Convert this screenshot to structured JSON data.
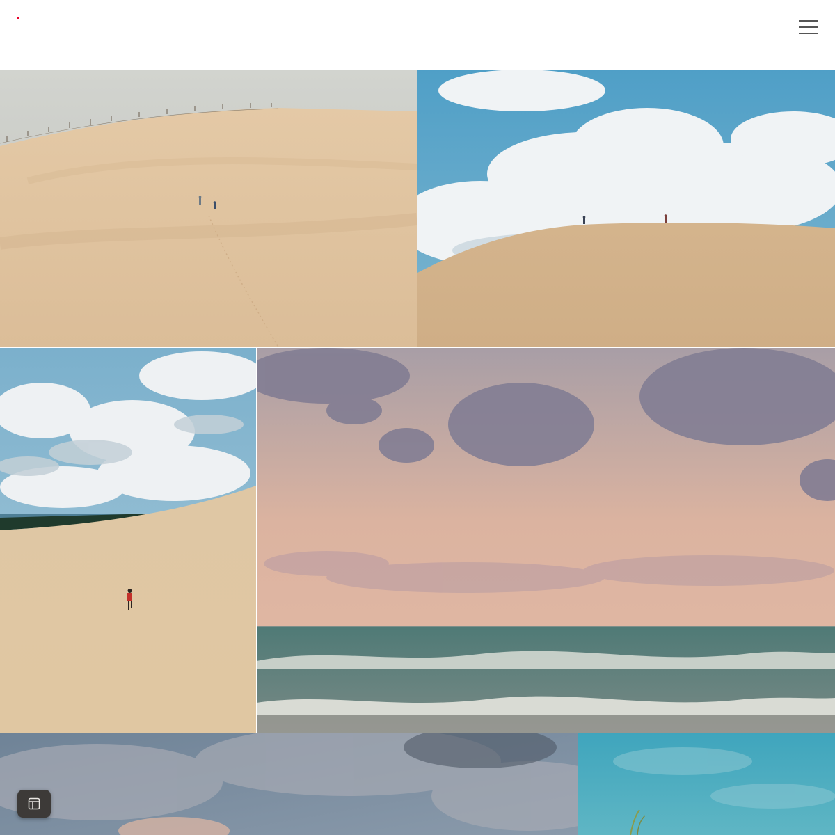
{
  "header": {
    "logo_dot_color": "#e8002a",
    "logo_icon": "logo-box",
    "menu_icon": "hamburger-menu-icon"
  },
  "gallery": {
    "tiles": [
      {
        "name": "photo-dune-fence-two-walkers",
        "icon": "photo"
      },
      {
        "name": "photo-dune-crest-clouds",
        "icon": "photo"
      },
      {
        "name": "photo-dune-child-running-lake",
        "icon": "photo"
      },
      {
        "name": "photo-sunset-lake-waves",
        "icon": "photo"
      },
      {
        "name": "photo-cloudy-sky",
        "icon": "photo"
      },
      {
        "name": "photo-turquoise-sky-grass",
        "icon": "photo"
      }
    ]
  },
  "floating_button": {
    "icon": "layout-icon",
    "background": "#3d3a38"
  }
}
